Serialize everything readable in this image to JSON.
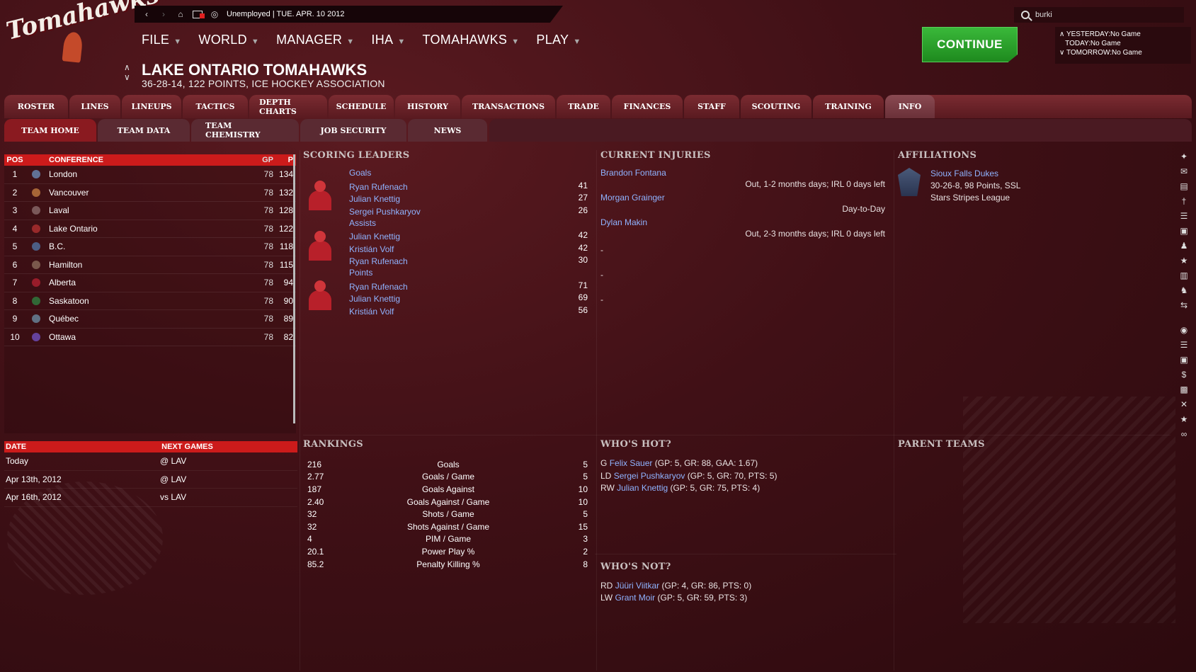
{
  "logo": {
    "text": "Tomahawks"
  },
  "topbar": {
    "status": "Unemployed",
    "date": "TUE. APR. 10 2012"
  },
  "search": {
    "value": "burki"
  },
  "menu": [
    {
      "label": "FILE"
    },
    {
      "label": "WORLD"
    },
    {
      "label": "MANAGER"
    },
    {
      "label": "IHA"
    },
    {
      "label": "TOMAHAWKS"
    },
    {
      "label": "PLAY"
    }
  ],
  "team": {
    "title": "LAKE ONTARIO TOMAHAWKS",
    "subtitle": "36-28-14, 122 POINTS, ICE HOCKEY ASSOCIATION"
  },
  "continue_label": "CONTINUE",
  "schedule": {
    "yesterday_label": "YESTERDAY:",
    "yesterday": "No Game",
    "today_label": "TODAY:",
    "today": "No Game",
    "tomorrow_label": "TOMORROW:",
    "tomorrow": "No Game"
  },
  "tabs": [
    "ROSTER",
    "LINES",
    "LINEUPS",
    "TACTICS",
    "DEPTH CHARTS",
    "SCHEDULE",
    "HISTORY",
    "TRANSACTIONS",
    "TRADE",
    "FINANCES",
    "STAFF",
    "SCOUTING",
    "TRAINING",
    "INFO"
  ],
  "subtabs": [
    "TEAM HOME",
    "TEAM DATA",
    "TEAM CHEMISTRY",
    "JOB SECURITY",
    "NEWS"
  ],
  "standings": {
    "headers": {
      "pos": "POS",
      "conference": "CONFERENCE",
      "gp": "GP",
      "p": "P"
    },
    "rows": [
      {
        "pos": "1",
        "team": "London",
        "gp": "78",
        "p": "134"
      },
      {
        "pos": "2",
        "team": "Vancouver",
        "gp": "78",
        "p": "132"
      },
      {
        "pos": "3",
        "team": "Laval",
        "gp": "78",
        "p": "128"
      },
      {
        "pos": "4",
        "team": "Lake Ontario",
        "gp": "78",
        "p": "122"
      },
      {
        "pos": "5",
        "team": "B.C.",
        "gp": "78",
        "p": "118"
      },
      {
        "pos": "6",
        "team": "Hamilton",
        "gp": "78",
        "p": "115"
      },
      {
        "pos": "7",
        "team": "Alberta",
        "gp": "78",
        "p": "94"
      },
      {
        "pos": "8",
        "team": "Saskatoon",
        "gp": "78",
        "p": "90"
      },
      {
        "pos": "9",
        "team": "Québec",
        "gp": "78",
        "p": "89"
      },
      {
        "pos": "10",
        "team": "Ottawa",
        "gp": "78",
        "p": "82"
      }
    ]
  },
  "next_games": {
    "headers": {
      "date": "DATE",
      "games": "NEXT GAMES"
    },
    "rows": [
      {
        "date": "Today",
        "opp": "@ LAV"
      },
      {
        "date": "Apr 13th, 2012",
        "opp": "@ LAV"
      },
      {
        "date": "Apr 16th, 2012",
        "opp": "vs LAV"
      }
    ]
  },
  "scoring": {
    "title": "SCORING LEADERS",
    "groups": [
      {
        "label": "Goals",
        "players": [
          {
            "name": "Ryan Rufenach",
            "val": "41"
          },
          {
            "name": "Julian Knettig",
            "val": "27"
          },
          {
            "name": "Sergei Pushkaryov",
            "val": "26"
          }
        ]
      },
      {
        "label": "Assists",
        "players": [
          {
            "name": "Julian Knettig",
            "val": "42"
          },
          {
            "name": "Kristián Volf",
            "val": "42"
          },
          {
            "name": "Ryan Rufenach",
            "val": "30"
          }
        ]
      },
      {
        "label": "Points",
        "players": [
          {
            "name": "Ryan Rufenach",
            "val": "71"
          },
          {
            "name": "Julian Knettig",
            "val": "69"
          },
          {
            "name": "Kristián Volf",
            "val": "56"
          }
        ]
      }
    ]
  },
  "rankings": {
    "title": "RANKINGS",
    "rows": [
      {
        "v": "216",
        "stat": "Goals",
        "rank": "5"
      },
      {
        "v": "2.77",
        "stat": "Goals / Game",
        "rank": "5"
      },
      {
        "v": "187",
        "stat": "Goals Against",
        "rank": "10"
      },
      {
        "v": "2.40",
        "stat": "Goals Against / Game",
        "rank": "10"
      },
      {
        "v": "32",
        "stat": "Shots / Game",
        "rank": "5"
      },
      {
        "v": "32",
        "stat": "Shots Against / Game",
        "rank": "15"
      },
      {
        "v": "4",
        "stat": "PIM / Game",
        "rank": "3"
      },
      {
        "v": "20.1",
        "stat": "Power Play %",
        "rank": "2"
      },
      {
        "v": "85.2",
        "stat": "Penalty Killing %",
        "rank": "8"
      }
    ]
  },
  "injuries": {
    "title": "CURRENT INJURIES",
    "rows": [
      {
        "name": "Brandon Fontana",
        "status": "Out, 1-2 months days; IRL 0 days left"
      },
      {
        "name": "Morgan Grainger",
        "status": "Day-to-Day"
      },
      {
        "name": "Dylan Makin",
        "status": "Out, 2-3 months days; IRL 0 days left"
      }
    ],
    "dashes": [
      "-",
      "-",
      "-"
    ]
  },
  "affiliations": {
    "title": "AFFILIATIONS",
    "team": "Sioux Falls Dukes",
    "record": "30-26-8, 98 Points, SSL",
    "league": "Stars Stripes League"
  },
  "parent_teams": {
    "title": "PARENT TEAMS"
  },
  "whos_hot": {
    "title": "WHO'S HOT?",
    "rows": [
      {
        "pos": "G",
        "name": "Felix Sauer",
        "stats": "(GP: 5, GR: 88, GAA: 1.67)"
      },
      {
        "pos": "LD",
        "name": "Sergei Pushkaryov",
        "stats": "(GP: 5, GR: 70, PTS: 5)"
      },
      {
        "pos": "RW",
        "name": "Julian Knettig",
        "stats": "(GP: 5, GR: 75, PTS: 4)"
      }
    ]
  },
  "whos_not": {
    "title": "WHO'S NOT?",
    "rows": [
      {
        "pos": "RD",
        "name": "Jüüri Viitkar",
        "stats": "(GP: 4, GR: 86, PTS: 0)"
      },
      {
        "pos": "LW",
        "name": "Grant Moir",
        "stats": "(GP: 5, GR: 59, PTS: 3)"
      }
    ]
  },
  "colors": {
    "accent": "#cc1b1b",
    "link": "#8fb3ff",
    "continue": "#2aa22a"
  }
}
